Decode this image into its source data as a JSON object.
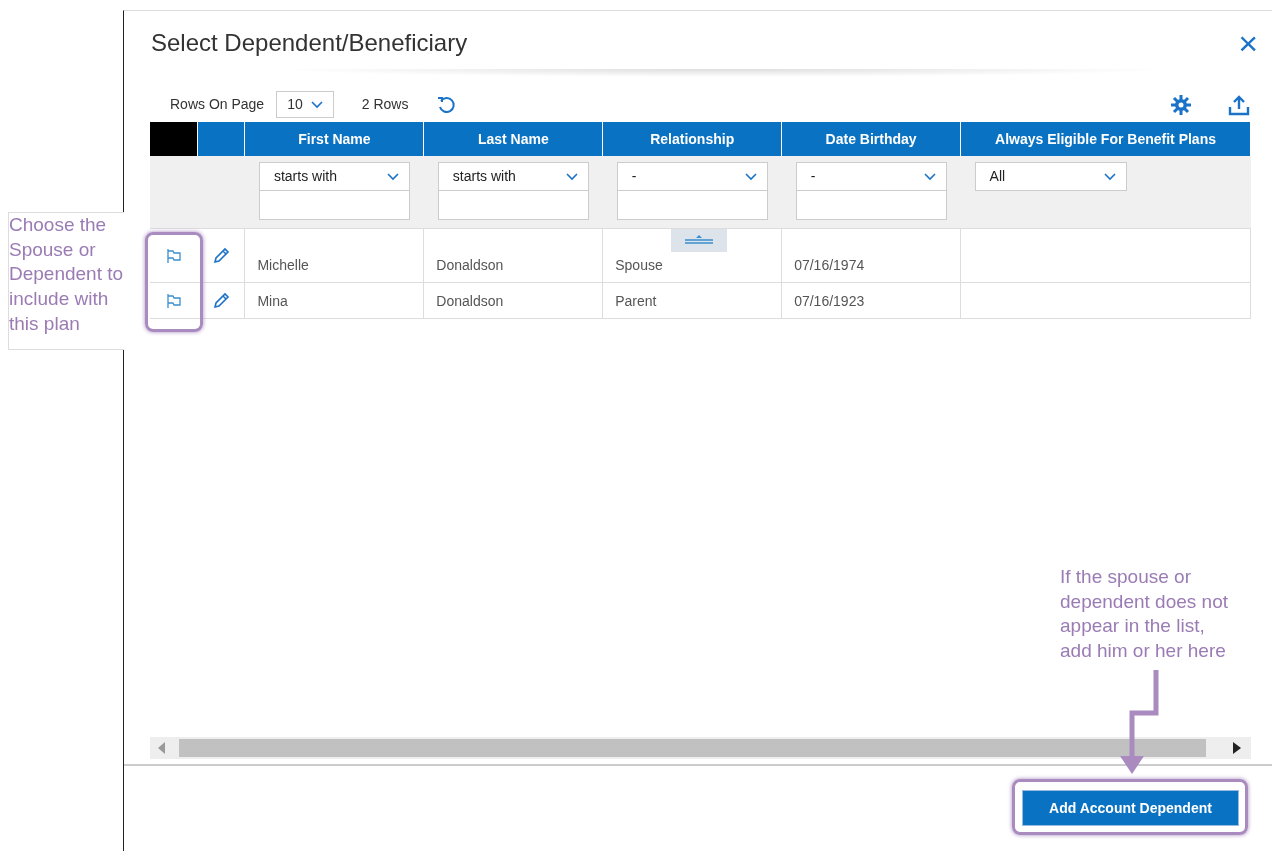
{
  "dialog": {
    "title": "Select Dependent/Beneficiary",
    "close": "×"
  },
  "toolbar": {
    "rows_label": "Rows On Page",
    "rows_value": "10",
    "row_count": "2 Rows"
  },
  "table": {
    "columns": [
      "First Name",
      "Last Name",
      "Relationship",
      "Date Birthday",
      "Always Eligible For Benefit Plans"
    ],
    "filters": [
      {
        "kind": "select_input",
        "value": "starts with"
      },
      {
        "kind": "select_input",
        "value": "starts with"
      },
      {
        "kind": "select_input",
        "value": "-"
      },
      {
        "kind": "select_input",
        "value": "-"
      },
      {
        "kind": "select",
        "value": "All"
      }
    ],
    "rows": [
      {
        "cells": [
          "Michelle",
          "Donaldson",
          "Spouse",
          "07/16/1974",
          ""
        ]
      },
      {
        "cells": [
          "Mina",
          "Donaldson",
          "Parent",
          "07/16/1923",
          ""
        ]
      }
    ]
  },
  "footer": {
    "button": "Add Account Dependent"
  },
  "annotations": [
    {
      "kind": "left",
      "text": "Choose the Spouse or Dependent to include with this plan"
    },
    {
      "kind": "bottom",
      "text": "If the spouse or dependent does not appear in the list, add him or her here"
    }
  ]
}
